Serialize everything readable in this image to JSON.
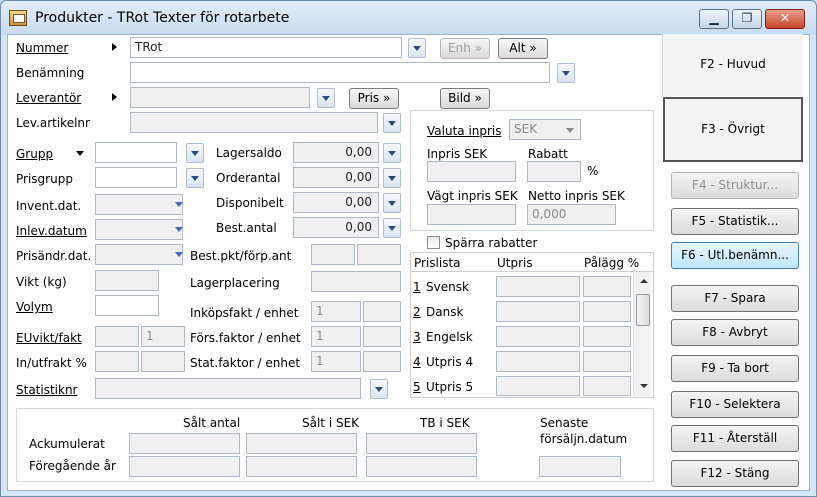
{
  "window": {
    "title": "Produkter - TRot Texter för rotarbete",
    "minimize": "▁",
    "maximize": "❐",
    "close": "✕"
  },
  "fields": {
    "nummer": {
      "label": "Nummer",
      "value": "TRot"
    },
    "benamning": {
      "label": "Benämning",
      "value": ""
    },
    "leverantor": {
      "label": "Leverantör",
      "value": ""
    },
    "lev_artikelnr": {
      "label": "Lev.artikelnr",
      "value": ""
    },
    "grupp": {
      "label": "Grupp",
      "value": ""
    },
    "prisgrupp": {
      "label": "Prisgrupp",
      "value": ""
    },
    "invent_dat": {
      "label": "Invent.dat.",
      "value": ""
    },
    "inlev_datum": {
      "label": "Inlev.datum",
      "value": ""
    },
    "prisandr_dat": {
      "label": "Prisändr.dat.",
      "value": ""
    },
    "vikt": {
      "label": "Vikt (kg)",
      "value": ""
    },
    "volym": {
      "label": "Volym",
      "value": ""
    },
    "euvikt_fakt": {
      "label": "EUvikt/fakt",
      "value": "",
      "value2": "1"
    },
    "in_utfrakt": {
      "label": "In/utfrakt %",
      "value": ""
    },
    "statistiknr": {
      "label": "Statistiknr",
      "value": ""
    }
  },
  "buttons": {
    "enh": "Enh »",
    "alt": "Alt »",
    "pris": "Pris »",
    "bild": "Bild »"
  },
  "stock": {
    "lagersaldo": {
      "label": "Lagersaldo",
      "value": "0,00"
    },
    "orderantal": {
      "label": "Orderantal",
      "value": "0,00"
    },
    "disponibelt": {
      "label": "Disponibelt",
      "value": "0,00"
    },
    "best_antal": {
      "label": "Best.antal",
      "value": "0,00"
    }
  },
  "extra": {
    "best_pkt": "Best.pkt/förp.ant",
    "lagerplacering": "Lagerplacering",
    "inkopsfakt": {
      "label": "Inköpsfakt / enhet",
      "value": "1"
    },
    "forsfaktor": {
      "label": "Förs.faktor / enhet",
      "value": "1"
    },
    "statfaktor": {
      "label": "Stat.faktor / enhet",
      "value": "1"
    }
  },
  "purchase": {
    "valuta_label": "Valuta inpris",
    "valuta_value": "SEK",
    "inpris_label": "Inpris SEK",
    "rabatt_label": "Rabatt",
    "rabatt_unit": "%",
    "vagt_label": "Vägt inpris SEK",
    "netto_label": "Netto inpris SEK",
    "netto_value": "0,000"
  },
  "pricelist": {
    "sparra_label": "Spärra rabatter",
    "headers": [
      "Prislista",
      "Utpris",
      "Pålägg %"
    ],
    "rows": [
      {
        "num": "1",
        "name": "Svensk"
      },
      {
        "num": "2",
        "name": "Dansk"
      },
      {
        "num": "3",
        "name": "Engelsk"
      },
      {
        "num": "4",
        "name": "Utpris 4"
      },
      {
        "num": "5",
        "name": "Utpris 5"
      }
    ]
  },
  "sales": {
    "headers": [
      "Sålt antal",
      "Sålt i SEK",
      "TB i SEK"
    ],
    "senaste_line1": "Senaste",
    "senaste_line2": "försäljn.datum",
    "rows": [
      "Ackumulerat",
      "Föregående år"
    ]
  },
  "side": {
    "f2": "F2 - Huvud",
    "f3": "F3 - Övrigt",
    "f4": "F4 - Struktur...",
    "f5": "F5 - Statistik...",
    "f6": "F6 - Utl.benämn...",
    "f7": "F7 - Spara",
    "f8": "F8 - Avbryt",
    "f9": "F9 - Ta bort",
    "f10": "F10 - Selektera",
    "f11": "F11 - Återställ",
    "f12": "F12 - Stäng"
  }
}
